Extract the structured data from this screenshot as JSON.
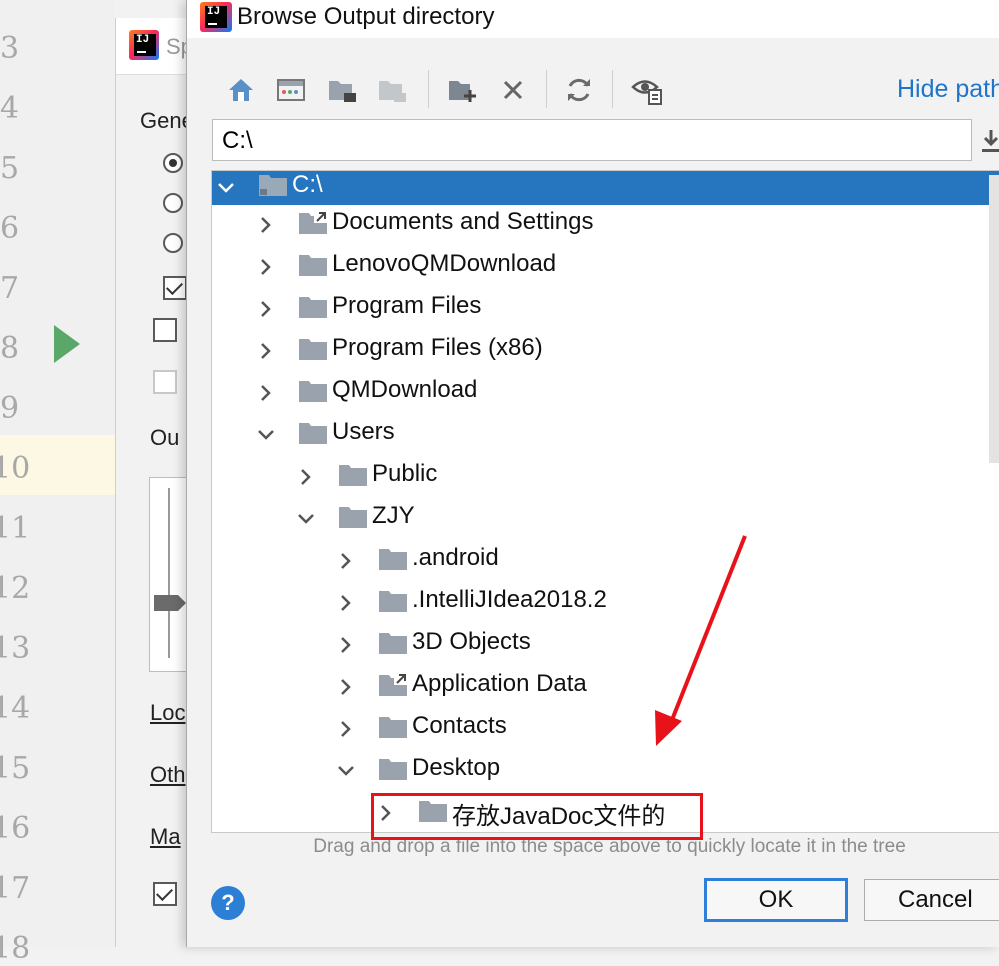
{
  "editor": {
    "line_numbers": [
      "3",
      "4",
      "5",
      "6",
      "7",
      "8",
      "9",
      "10",
      "11",
      "12",
      "13",
      "14",
      "15",
      "16",
      "17",
      "18"
    ]
  },
  "background_dialog": {
    "title": "Sp",
    "section_general": "Gene",
    "section_output": "Ou",
    "link_locale": "Loc",
    "link_other": "Oth",
    "link_max": "Ma"
  },
  "dialog": {
    "title": "Browse Output directory",
    "toolbar": {
      "items": [
        "home-icon",
        "desktop-icon",
        "project-icon",
        "module-icon",
        "new-folder-icon",
        "delete-icon",
        "refresh-icon",
        "show-hidden-icon"
      ],
      "hide_path": "Hide path"
    },
    "path": {
      "value": "C:\\"
    },
    "tree": {
      "root": "C:\\",
      "nodes": [
        {
          "label": "Documents and Settings",
          "icon": "folder-link-icon"
        },
        {
          "label": "LenovoQMDownload",
          "icon": "folder-icon"
        },
        {
          "label": "Program Files",
          "icon": "folder-icon"
        },
        {
          "label": "Program Files (x86)",
          "icon": "folder-icon"
        },
        {
          "label": "QMDownload",
          "icon": "folder-icon"
        },
        {
          "label": "Users",
          "icon": "folder-icon"
        },
        {
          "label": "Public",
          "icon": "folder-icon"
        },
        {
          "label": "ZJY",
          "icon": "folder-icon"
        },
        {
          "label": ".android",
          "icon": "folder-icon"
        },
        {
          "label": ".IntelliJIdea2018.2",
          "icon": "folder-icon"
        },
        {
          "label": "3D Objects",
          "icon": "folder-icon"
        },
        {
          "label": "Application Data",
          "icon": "folder-link-icon"
        },
        {
          "label": "Contacts",
          "icon": "folder-icon"
        },
        {
          "label": "Desktop",
          "icon": "folder-icon"
        },
        {
          "label": "存放JavaDoc文件的",
          "icon": "folder-icon"
        }
      ]
    },
    "hint": "Drag and drop a file into the space above to quickly locate it in the tree",
    "buttons": {
      "help": "?",
      "ok": "OK",
      "cancel": "Cancel"
    },
    "colors": {
      "selection": "#2675bf",
      "link": "#2175c9",
      "annotation": "#e8131a"
    }
  }
}
